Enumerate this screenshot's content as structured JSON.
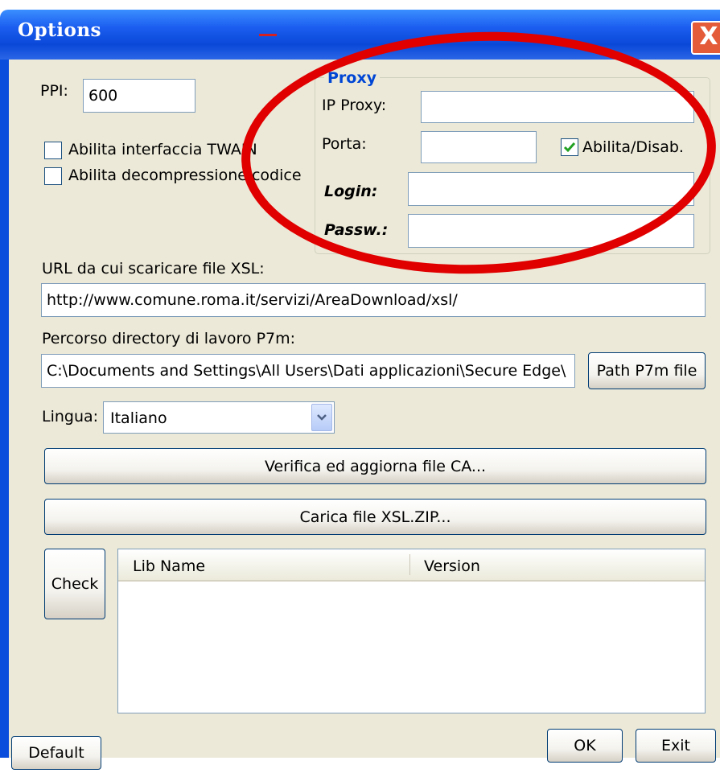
{
  "window": {
    "title": "Options",
    "close_label": "X"
  },
  "ppi": {
    "label": "PPI:",
    "value": "600"
  },
  "checkboxes": {
    "twain": {
      "label": "Abilita interfaccia TWAIN",
      "checked": false
    },
    "decompress": {
      "label": "Abilita decompressione codice",
      "checked": false
    }
  },
  "proxy": {
    "legend": "Proxy",
    "ip_label": "IP Proxy:",
    "ip_value": "",
    "port_label": "Porta:",
    "port_value": "",
    "enable_label": "Abilita/Disab.",
    "enable_checked": true,
    "login_label": "Login:",
    "login_value": "",
    "passw_label": "Passw.:",
    "passw_value": ""
  },
  "xsl": {
    "label": "URL da cui scaricare file XSL:",
    "value": "http://www.comune.roma.it/servizi/AreaDownload/xsl/"
  },
  "p7m": {
    "label": "Percorso directory di lavoro P7m:",
    "value": "C:\\Documents and Settings\\All Users\\Dati applicazioni\\Secure Edge\\",
    "button": "Path P7m file"
  },
  "language": {
    "label": "Lingua:",
    "selected": "Italiano"
  },
  "buttons": {
    "verify_ca": "Verifica ed aggiorna file CA...",
    "load_xsl": "Carica file XSL.ZIP...",
    "check": "Check",
    "default": "Default",
    "ok": "OK",
    "exit": "Exit"
  },
  "table": {
    "columns": [
      "Lib Name",
      "Version"
    ],
    "rows": []
  },
  "colors": {
    "title_bar": "#0a48d8",
    "dialog_bg": "#ece9d8",
    "annotation": "#e00000",
    "legend": "#0046d5"
  },
  "icons": {
    "checkmark": "check-icon",
    "dropdown": "chevron-down-icon",
    "close": "close-icon"
  }
}
